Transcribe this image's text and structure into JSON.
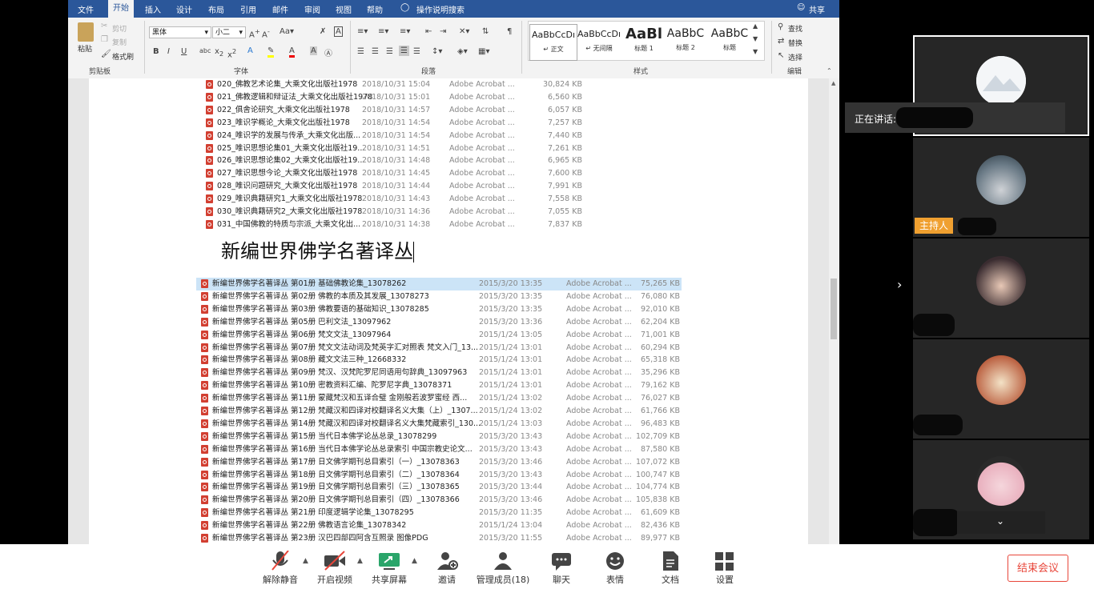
{
  "word": {
    "tabs": [
      "文件",
      "开始",
      "插入",
      "设计",
      "布局",
      "引用",
      "邮件",
      "审阅",
      "视图",
      "帮助"
    ],
    "tell_me": "操作说明搜索",
    "share": "共享",
    "clipboard": {
      "paste": "粘贴",
      "cut": "剪切",
      "copy": "复制",
      "format_painter": "格式刷",
      "group": "剪贴板"
    },
    "font": {
      "name": "黑体",
      "size": "小二",
      "group": "字体"
    },
    "paragraph": {
      "group": "段落"
    },
    "styles": {
      "items": [
        {
          "preview": "AaBbCcDı",
          "name": "↵ 正文"
        },
        {
          "preview": "AaBbCcDı",
          "name": "↵ 无间隔"
        },
        {
          "preview": "AaBl",
          "name": "标题 1"
        },
        {
          "preview": "AaBbC",
          "name": "标题 2"
        },
        {
          "preview": "AaBbC",
          "name": "标题"
        }
      ],
      "group": "样式"
    },
    "editing": {
      "find": "查找",
      "replace": "替换",
      "select": "选择",
      "group": "编辑"
    },
    "list1": [
      {
        "name": "020_佛教艺术论集_大乘文化出版社1978",
        "date": "2018/10/31 15:04",
        "type": "Adobe Acrobat ...",
        "size": "30,824 KB"
      },
      {
        "name": "021_佛教逻辑和辩证法_大乘文化出版社1978",
        "date": "2018/10/31 15:01",
        "type": "Adobe Acrobat ...",
        "size": "6,560 KB"
      },
      {
        "name": "022_俱舍论研究_大乘文化出版社1978",
        "date": "2018/10/31 14:57",
        "type": "Adobe Acrobat ...",
        "size": "6,057 KB"
      },
      {
        "name": "023_唯识学概论_大乘文化出版社1978",
        "date": "2018/10/31 14:54",
        "type": "Adobe Acrobat ...",
        "size": "7,257 KB"
      },
      {
        "name": "024_唯识学的发展与传承_大乘文化出版...",
        "date": "2018/10/31 14:54",
        "type": "Adobe Acrobat ...",
        "size": "7,440 KB"
      },
      {
        "name": "025_唯识思想论集01_大乘文化出版社19...",
        "date": "2018/10/31 14:51",
        "type": "Adobe Acrobat ...",
        "size": "7,261 KB"
      },
      {
        "name": "026_唯识思想论集02_大乘文化出版社19...",
        "date": "2018/10/31 14:48",
        "type": "Adobe Acrobat ...",
        "size": "6,965 KB"
      },
      {
        "name": "027_唯识思想今论_大乘文化出版社1978",
        "date": "2018/10/31 14:45",
        "type": "Adobe Acrobat ...",
        "size": "7,600 KB"
      },
      {
        "name": "028_唯识问题研究_大乘文化出版社1978",
        "date": "2018/10/31 14:44",
        "type": "Adobe Acrobat ...",
        "size": "7,991 KB"
      },
      {
        "name": "029_唯识典籍研究1_大乘文化出版社1978",
        "date": "2018/10/31 14:43",
        "type": "Adobe Acrobat ...",
        "size": "7,558 KB"
      },
      {
        "name": "030_唯识典籍研究2_大乘文化出版社1978",
        "date": "2018/10/31 14:36",
        "type": "Adobe Acrobat ...",
        "size": "7,055 KB"
      },
      {
        "name": "031_中国佛教的特质与宗派_大乘文化出...",
        "date": "2018/10/31 14:38",
        "type": "Adobe Acrobat ...",
        "size": "7,837 KB"
      }
    ],
    "heading": "新编世界佛学名著译丛",
    "list2": [
      {
        "name": "新编世界佛学名著译丛  第01册  基础佛教论集_13078262",
        "date": "2015/3/20 13:35",
        "type": "Adobe Acrobat ...",
        "size": "75,265 KB"
      },
      {
        "name": "新编世界佛学名著译丛  第02册  佛教的本质及其发展_13078273",
        "date": "2015/3/20 13:35",
        "type": "Adobe Acrobat ...",
        "size": "76,080 KB"
      },
      {
        "name": "新编世界佛学名著译丛  第03册  佛教要语的基础知识_13078285",
        "date": "2015/3/20 13:35",
        "type": "Adobe Acrobat ...",
        "size": "92,010 KB"
      },
      {
        "name": "新编世界佛学名著译丛  第05册  巴利文法_13097962",
        "date": "2015/3/20 13:36",
        "type": "Adobe Acrobat ...",
        "size": "62,204 KB"
      },
      {
        "name": "新编世界佛学名著译丛  第06册  梵文文法_13097964",
        "date": "2015/1/24 13:05",
        "type": "Adobe Acrobat ...",
        "size": "71,001 KB"
      },
      {
        "name": "新编世界佛学名著译丛  第07册  梵文文法动词及梵英字汇对照表  梵文入门_13...",
        "date": "2015/1/24 13:01",
        "type": "Adobe Acrobat ...",
        "size": "60,294 KB"
      },
      {
        "name": "新编世界佛学名著译丛  第08册  藏文文法三种_12668332",
        "date": "2015/1/24 13:01",
        "type": "Adobe Acrobat ...",
        "size": "65,318 KB"
      },
      {
        "name": "新编世界佛学名著译丛  第09册  梵汉、汉梵陀罗尼同语用句辞典_13097963",
        "date": "2015/1/24 13:01",
        "type": "Adobe Acrobat ...",
        "size": "35,296 KB"
      },
      {
        "name": "新编世界佛学名著译丛  第10册  密教资料汇编、陀罗尼字典_13078371",
        "date": "2015/1/24 13:01",
        "type": "Adobe Acrobat ...",
        "size": "79,162 KB"
      },
      {
        "name": "新编世界佛学名著译丛  第11册  蒙藏梵汉和五译合璧  金刚般若波罗蜜经  西...",
        "date": "2015/1/24 13:02",
        "type": "Adobe Acrobat ...",
        "size": "76,027 KB"
      },
      {
        "name": "新编世界佛学名著译丛  第12册  梵藏汉和四译对校翻译名义大集（上）_1307...",
        "date": "2015/1/24 13:02",
        "type": "Adobe Acrobat ...",
        "size": "61,766 KB"
      },
      {
        "name": "新编世界佛学名著译丛  第14册  梵藏汉和四译对校翻译名义大集梵藏索引_130...",
        "date": "2015/1/24 13:03",
        "type": "Adobe Acrobat ...",
        "size": "96,483 KB"
      },
      {
        "name": "新编世界佛学名著译丛  第15册  当代日本佛学论丛总录_13078299",
        "date": "2015/3/20 13:43",
        "type": "Adobe Acrobat ...",
        "size": "102,709 KB"
      },
      {
        "name": "新编世界佛学名著译丛  第16册  当代日本佛学论丛总录索引  中国宗教史论文...",
        "date": "2015/3/20 13:43",
        "type": "Adobe Acrobat ...",
        "size": "87,580 KB"
      },
      {
        "name": "新编世界佛学名著译丛  第17册  日文佛学期刊总目索引（一）_13078363",
        "date": "2015/3/20 13:46",
        "type": "Adobe Acrobat ...",
        "size": "107,072 KB"
      },
      {
        "name": "新编世界佛学名著译丛  第18册  日文佛学期刊总目索引（二）_13078364",
        "date": "2015/3/20 13:43",
        "type": "Adobe Acrobat ...",
        "size": "100,747 KB"
      },
      {
        "name": "新编世界佛学名著译丛  第19册  日文佛学期刊总目索引（三）_13078365",
        "date": "2015/3/20 13:44",
        "type": "Adobe Acrobat ...",
        "size": "104,774 KB"
      },
      {
        "name": "新编世界佛学名著译丛  第20册  日文佛学期刊总目索引（四）_13078366",
        "date": "2015/3/20 13:46",
        "type": "Adobe Acrobat ...",
        "size": "105,838 KB"
      },
      {
        "name": "新编世界佛学名著译丛  第21册  印度逻辑学论集_13078295",
        "date": "2015/3/20 11:35",
        "type": "Adobe Acrobat ...",
        "size": "61,609 KB"
      },
      {
        "name": "新编世界佛学名著译丛  第22册  佛教语言论集_13078342",
        "date": "2015/1/24 13:04",
        "type": "Adobe Acrobat ...",
        "size": "82,436 KB"
      },
      {
        "name": "新编世界佛学名著译丛  第23册  汉巴四部四阿含互照录      图像PDG",
        "date": "2015/3/20 11:55",
        "type": "Adobe Acrobat ...",
        "size": "89,977 KB"
      }
    ]
  },
  "meeting": {
    "speaking_label": "正在讲话:",
    "host_label": "主持人",
    "toolbar": [
      {
        "label": "解除静音",
        "icon": "mic-muted-icon"
      },
      {
        "label": "开启视频",
        "icon": "video-off-icon"
      },
      {
        "label": "共享屏幕",
        "icon": "share-screen-icon"
      },
      {
        "label": "邀请",
        "icon": "add-user-icon"
      },
      {
        "label": "管理成员(18)",
        "icon": "members-icon"
      },
      {
        "label": "聊天",
        "icon": "chat-icon"
      },
      {
        "label": "表情",
        "icon": "emoji-icon"
      },
      {
        "label": "文档",
        "icon": "document-icon"
      },
      {
        "label": "设置",
        "icon": "settings-icon"
      }
    ],
    "end_meeting": "结束会议",
    "colors": {
      "accent": "#2b579a",
      "host_badge": "#f0a030",
      "end": "#e8463a"
    }
  }
}
